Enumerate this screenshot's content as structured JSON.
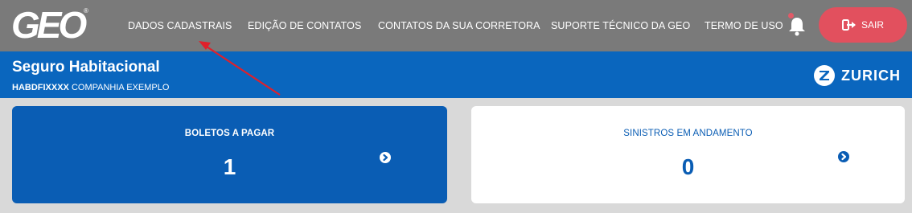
{
  "header": {
    "logo_text": "GEO",
    "logo_mark": "®",
    "nav": [
      {
        "label": "DADOS CADASTRAIS"
      },
      {
        "label": "EDIÇÃO DE CONTATOS"
      },
      {
        "label": "CONTATOS DA SUA CORRETORA"
      },
      {
        "label": "SUPORTE TÉCNICO DA GEO"
      },
      {
        "label": "TERMO DE USO"
      }
    ],
    "bell_icon": "bell-icon",
    "logout_label": "SAIR",
    "logout_icon": "sign-out-icon"
  },
  "product": {
    "title": "Seguro Habitacional",
    "code": "HABDFIXXXX",
    "company": "COMPANHIA EXEMPLO",
    "brand": "ZURICH"
  },
  "cards": [
    {
      "label": "BOLETOS A PAGAR",
      "value": "1",
      "icon": "chevron-right-circle-icon"
    },
    {
      "label": "SINISTROS EM ANDAMENTO",
      "value": "0",
      "icon": "chevron-right-circle-icon"
    }
  ],
  "colors": {
    "topbar": "#7a7a7a",
    "primary_blue": "#0a66be",
    "card_blue": "#0a5db4",
    "logout_red": "#e2505e",
    "annotation_arrow": "#e0202a"
  }
}
